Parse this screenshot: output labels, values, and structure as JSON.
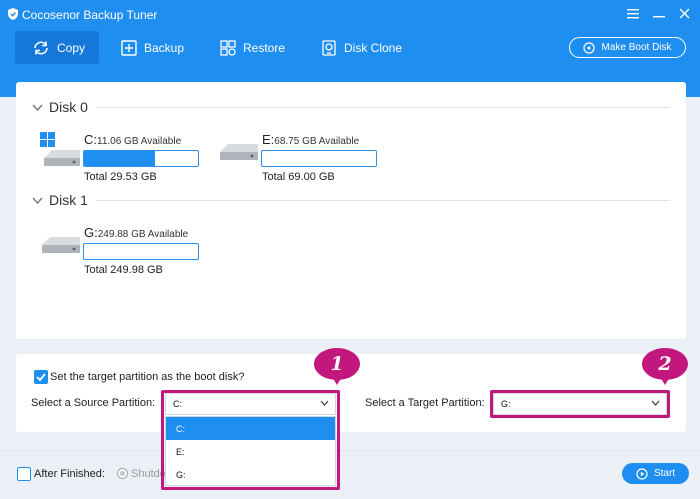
{
  "window": {
    "title": "Cocosenor Backup Tuner",
    "logo_icon": "shield-logo-icon",
    "menu_icon": "hamburger-icon",
    "minimize_icon": "minimize-icon",
    "close_icon": "close-icon"
  },
  "nav": {
    "items": [
      {
        "label": "Copy",
        "icon": "sync-icon",
        "active": true
      },
      {
        "label": "Backup",
        "icon": "plus-box-icon",
        "active": false
      },
      {
        "label": "Restore",
        "icon": "restore-grid-icon",
        "active": false
      },
      {
        "label": "Disk Clone",
        "icon": "disk-clone-icon",
        "active": false
      }
    ],
    "boot_button": "Make Boot Disk"
  },
  "disks": [
    {
      "name": "Disk 0",
      "partitions": [
        {
          "letter": "C:",
          "available": "11.06 GB Available",
          "total": "Total 29.53 GB",
          "used_fraction": 0.62,
          "icon": "windows-drive-icon"
        },
        {
          "letter": "E:",
          "available": "68.75 GB Available",
          "total": "Total 69.00 GB",
          "used_fraction": 0.0,
          "icon": "drive-icon"
        }
      ]
    },
    {
      "name": "Disk 1",
      "partitions": [
        {
          "letter": "G:",
          "available": "249.88 GB Available",
          "total": "Total 249.98 GB",
          "used_fraction": 0.0,
          "icon": "drive-icon"
        }
      ]
    }
  ],
  "settings": {
    "boot_checkbox_label": "Set the target partition as the boot disk?",
    "boot_checked": true,
    "source_label": "Select a Source Partition:",
    "source_value": "C:",
    "target_label": "Select a Target Partition:",
    "target_value": "G:",
    "source_options": [
      "C:",
      "E:",
      "G:"
    ]
  },
  "annotations": {
    "badge_1": "1",
    "badge_2": "2",
    "color": "#c2177c"
  },
  "footer": {
    "after_finished_label": "After Finished:",
    "shutdown_label": "Shutdo",
    "start_label": "Start"
  },
  "colors": {
    "accent": "#1e8ef0",
    "accent_dark": "#1478d8",
    "highlight": "#c2177c"
  }
}
